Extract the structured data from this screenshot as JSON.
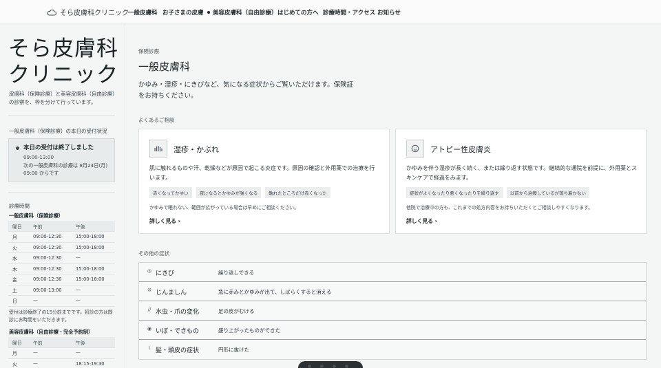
{
  "nav": {
    "brand": "そら皮膚科クリニック",
    "items": [
      "一般皮膚科",
      "お子さまの皮膚",
      "美容皮膚科（自由診療）",
      "はじめての方へ",
      "診療時間・アクセス",
      "お知らせ"
    ]
  },
  "sidebar": {
    "title_line1": "そら皮膚科",
    "title_line2": "クリニック",
    "description": "皮膚科（保険診療）と美容皮膚科（自由診療）の診察を、枠を分けて行っています。",
    "status_label": "一般皮膚科（保険診療）の本日の受付状況",
    "status_main": "本日の受付は終了しました",
    "status_hours": "09:00-13:00",
    "status_next": "次の一般皮膚科の診療は 8月24日(月) 09:00 からです",
    "hours_label": "診療時間",
    "insurance_title": "一般皮膚科（保険診療）",
    "insurance_head": [
      "曜日",
      "午前",
      "午後"
    ],
    "insurance_rows": [
      [
        "月",
        "09:00-12:30",
        "15:00-18:00"
      ],
      [
        "火",
        "09:00-12:30",
        "15:00-18:00"
      ],
      [
        "水",
        "09:00-12:30",
        "—"
      ],
      [
        "木",
        "09:00-12:30",
        "15:00-18:00"
      ],
      [
        "金",
        "09:00-12:30",
        "15:00-18:00"
      ],
      [
        "土",
        "09:00-13:00",
        "—"
      ],
      [
        "日",
        "—",
        "—"
      ]
    ],
    "note": "受付は診療終了の15分前までです。初診の方は問診にお時間をいただきます。",
    "beauty_title": "美容皮膚科（自由診療・完全予約制）",
    "beauty_head": [
      "曜日",
      "午前",
      "午後"
    ],
    "beauty_rows": [
      [
        "月",
        "—",
        "—"
      ],
      [
        "火",
        "—",
        "18:15-19:30"
      ]
    ]
  },
  "main": {
    "eyebrow": "保険診療",
    "title": "一般皮膚科",
    "lead": "かゆみ・湿疹・にきびなど、気になる症状からご覧いただけます。保険証をお持ちください。",
    "common_label": "よくあるご相談",
    "cards": [
      {
        "icon": "hand-icon",
        "title": "湿疹・かぶれ",
        "desc": "肌に触れるものや汗、乾燥などが原因で起こる炎症です。原因の確認と外用薬での治療を行います。",
        "tags": [
          "赤くなってかゆい",
          "夜になるとかゆみが強くなる",
          "触れたところだけ赤くなった"
        ],
        "note": "かゆみで眠れない、範囲が広がっている場合は早めにご相談ください。",
        "link": "詳しく見る"
      },
      {
        "icon": "face-icon",
        "title": "アトピー性皮膚炎",
        "desc": "かゆみを伴う湿疹が長く続く、または繰り返す状態です。継続的な通院を前提に、外用薬とスキンケアで経過をみます。",
        "tags": [
          "症状がよくなったり悪くなったりを繰り返す",
          "以前から治療しているが落ち着かない"
        ],
        "note": "他院で治療中の方も、これまでの処方内容をお持ちいただくとご相談しやすくなります。",
        "link": "詳しく見る"
      }
    ],
    "other_label": "その他の症状",
    "others": [
      {
        "icon": "acne-icon",
        "name": "にきび",
        "desc": "繰り返しできる"
      },
      {
        "icon": "rash-icon",
        "name": "じんましん",
        "desc": "急に赤みとかゆみが出て、しばらくすると消える"
      },
      {
        "icon": "nail-icon",
        "name": "水虫・爪の変化",
        "desc": "足の皮がむける"
      },
      {
        "icon": "wart-icon",
        "name": "いぼ・できもの",
        "desc": "盛り上がったものができた"
      },
      {
        "icon": "hair-icon",
        "name": "髪・頭皮の症状",
        "desc": "円形に抜けた"
      }
    ]
  }
}
